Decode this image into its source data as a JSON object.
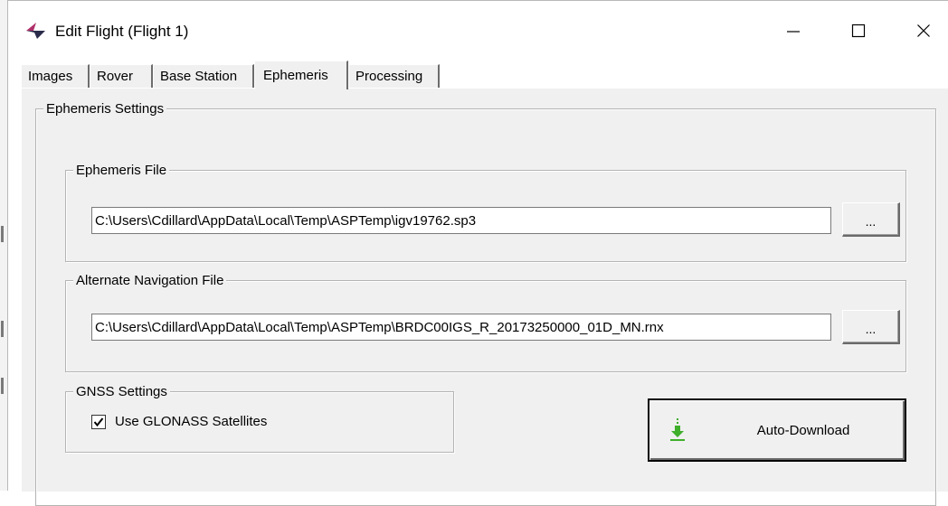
{
  "window": {
    "title": "Edit Flight (Flight 1)",
    "controls": [
      "minimize",
      "maximize",
      "close"
    ]
  },
  "tabs": [
    {
      "label": "Images",
      "active": false
    },
    {
      "label": "Rover",
      "active": false
    },
    {
      "label": "Base Station",
      "active": false
    },
    {
      "label": "Ephemeris",
      "active": true
    },
    {
      "label": "Processing",
      "active": false
    }
  ],
  "ephemeris_settings": {
    "title": "Ephemeris Settings",
    "ephemeris_file": {
      "title": "Ephemeris File",
      "value": "C:\\Users\\Cdillard\\AppData\\Local\\Temp\\ASPTemp\\igv19762.sp3",
      "browse_label": "..."
    },
    "alternate_navigation_file": {
      "title": "Alternate Navigation File",
      "value": "C:\\Users\\Cdillard\\AppData\\Local\\Temp\\ASPTemp\\BRDC00IGS_R_20173250000_01D_MN.rnx",
      "browse_label": "..."
    },
    "gnss_settings": {
      "title": "GNSS Settings",
      "use_glonass_label": "Use GLONASS Satellites",
      "use_glonass_checked": true
    },
    "auto_download_label": "Auto-Download"
  },
  "colors": {
    "panel": "#f0f0f0",
    "download_icon": "#3fae2a",
    "app_icon_dark": "#2b2b4a",
    "app_icon_accent": "#b0306a"
  },
  "icons": [
    "app-logo-icon",
    "minimize-icon",
    "maximize-icon",
    "close-icon",
    "checkmark-icon",
    "download-arrow-icon"
  ]
}
